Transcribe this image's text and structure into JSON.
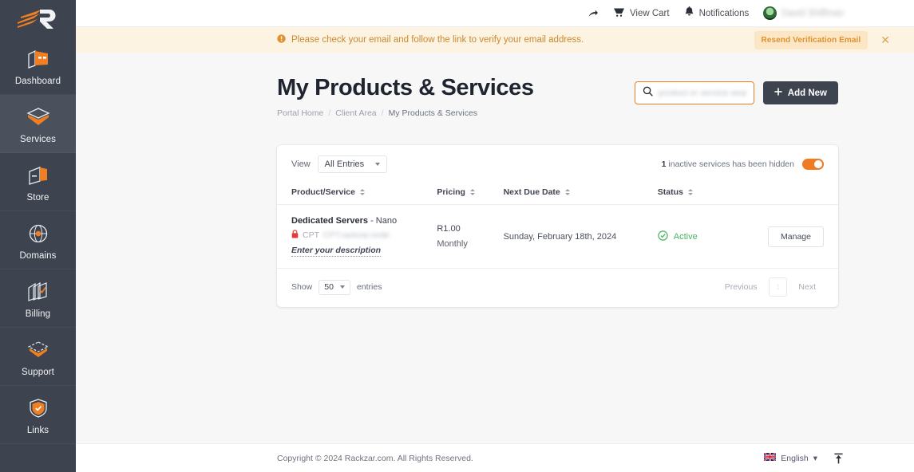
{
  "brand": {
    "logo_alt": "Rackzar logo",
    "accent": "#ef7f22",
    "sidebar_bg": "#3e444f"
  },
  "sidebar": {
    "items": [
      {
        "label": "Dashboard",
        "icon": "dashboard-icon",
        "active": false
      },
      {
        "label": "Services",
        "icon": "services-box-icon",
        "active": true
      },
      {
        "label": "Store",
        "icon": "store-icon",
        "active": false
      },
      {
        "label": "Domains",
        "icon": "globe-icon",
        "active": false
      },
      {
        "label": "Billing",
        "icon": "billing-invoices-icon",
        "active": false
      },
      {
        "label": "Support",
        "icon": "support-box-icon",
        "active": false
      },
      {
        "label": "Links",
        "icon": "shield-check-icon",
        "active": false
      }
    ]
  },
  "topbar": {
    "share_icon": "share-arrow-icon",
    "cart_label": "View Cart",
    "cart_icon": "cart-icon",
    "notifications_label": "Notifications",
    "notifications_icon": "bell-icon",
    "username": "David Shiffman",
    "avatar_icon": "user-avatar"
  },
  "alert": {
    "icon": "info-circle-icon",
    "message": "Please check your email and follow the link to verify your email address.",
    "action_label": "Resend Verification Email",
    "close_icon": "close-icon",
    "close_label": "✕"
  },
  "page": {
    "title": "My Products & Services",
    "breadcrumb": [
      {
        "label": "Portal Home",
        "current": false
      },
      {
        "label": "Client Area",
        "current": false
      },
      {
        "label": "My Products & Services",
        "current": true
      }
    ],
    "breadcrumb_separator": "/"
  },
  "search": {
    "icon": "search-icon",
    "placeholder": "product or service search",
    "value": ""
  },
  "add_new": {
    "label": "Add New",
    "icon": "plus-icon"
  },
  "table_controls": {
    "view_label": "View",
    "view_value": "All Entries",
    "hidden_count": "1",
    "hidden_text": "inactive services has been hidden",
    "toggle_on": true
  },
  "table": {
    "columns": [
      {
        "label": "Product/Service",
        "sortable": true
      },
      {
        "label": "Pricing",
        "sortable": true
      },
      {
        "label": "Next Due Date",
        "sortable": true
      },
      {
        "label": "Status",
        "sortable": true
      },
      {
        "label": "",
        "sortable": false
      }
    ],
    "rows": [
      {
        "product_group": "Dedicated Servers",
        "product_dash": "-",
        "product_name": "Nano",
        "hostname_prefix": "CPT",
        "hostname_blurred": "CPT.rackzar.node",
        "hostname_icon": "red-lock-icon",
        "description_link": "Enter your description",
        "price_amount": "R1.00",
        "price_cycle": "Monthly",
        "next_due_date": "Sunday, February 18th, 2024",
        "status": "Active",
        "status_icon": "check-circle-icon",
        "status_color": "#48b461",
        "action_label": "Manage"
      }
    ]
  },
  "pagination": {
    "show_label": "Show",
    "page_size": "50",
    "entries_label": "entries",
    "previous_label": "Previous",
    "current_page": "1",
    "next_label": "Next"
  },
  "footer": {
    "copyright": "Copyright © 2024 Rackzar.com. All Rights Reserved.",
    "language": "English",
    "language_caret": "▾",
    "flag_icon": "uk-flag-icon",
    "scroll_top_icon": "scroll-to-top-icon"
  }
}
